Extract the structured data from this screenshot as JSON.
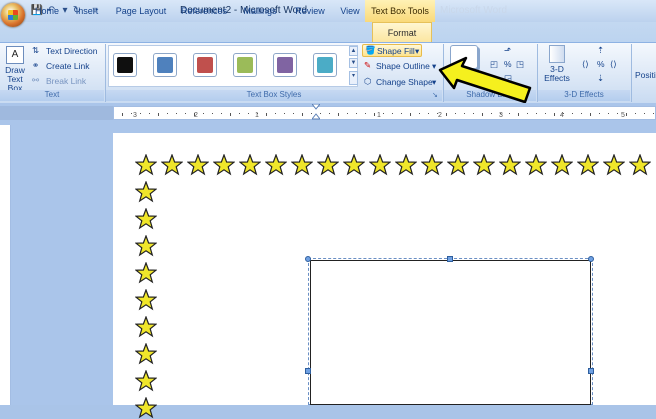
{
  "title_bar": {
    "doc_title": "Document2 - Microsoft Word",
    "context_tools": "Text Box Tools",
    "ghost_title": "Microsoft Word"
  },
  "tabs": [
    "Home",
    "Insert",
    "Page Layout",
    "References",
    "Mailings",
    "Review",
    "View"
  ],
  "active_tab": "Format",
  "ribbon": {
    "text_group": {
      "label": "Text",
      "draw_text_box": "Draw Text Box",
      "text_direction": "Text Direction",
      "create_link": "Create Link",
      "break_link": "Break Link"
    },
    "text_box_styles": {
      "label": "Text Box Styles",
      "swatches": [
        "#0f0f0f",
        "#4f81bd",
        "#c0504d",
        "#9bbb59",
        "#8064a2",
        "#4bacc6"
      ],
      "shape_fill": "Shape Fill",
      "shape_outline": "Shape Outline",
      "change_shape": "Change Shape"
    },
    "shadow_effects": {
      "label": "Shadow Eff..."
    },
    "three_d": {
      "label": "3-D Effects",
      "button": "3-D Effects"
    },
    "position": {
      "label": "Positi..."
    }
  },
  "annotation": {
    "arrow_color": "#f5f01e",
    "arrow_outline": "#000000"
  },
  "page": {
    "border_star_color": "#f0e62a"
  }
}
